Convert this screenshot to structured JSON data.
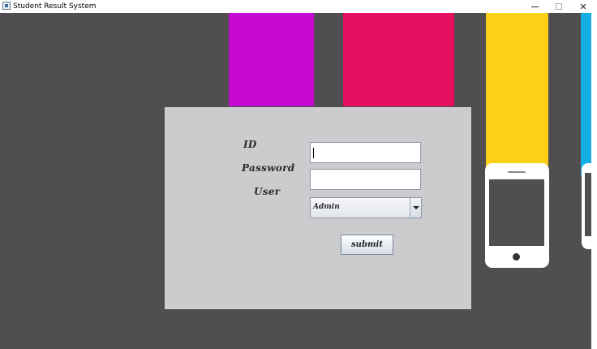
{
  "window": {
    "title": "Student Result System",
    "minimize_symbol": "",
    "maximize_symbol": "",
    "close_symbol": "✕"
  },
  "form": {
    "id_label": "ID",
    "password_label": "Password",
    "user_label": "User",
    "id_value": "",
    "password_value": "",
    "user_selected": "Admin",
    "submit_label": "submit"
  },
  "colors": {
    "background": "#504e50",
    "panel": "#cccbcd",
    "stripe_magenta": "#c609cf",
    "stripe_pink": "#e5105f",
    "stripe_yellow": "#fcd016",
    "stripe_blue": "#13aee4"
  },
  "icons": {
    "app": "java-app-icon",
    "phone": "smartphone-icon"
  }
}
